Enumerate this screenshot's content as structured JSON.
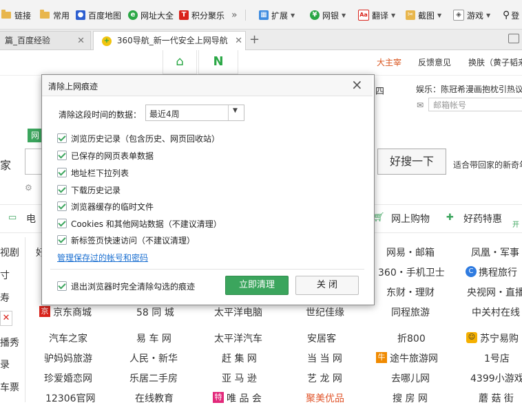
{
  "bookmarks": {
    "items": [
      {
        "label": "链接"
      },
      {
        "label": "常用"
      },
      {
        "label": "百度地图"
      },
      {
        "label": "网址大全"
      },
      {
        "label": "积分聚乐"
      },
      {
        "label": "扩展"
      },
      {
        "label": "网银"
      },
      {
        "label": "翻译"
      },
      {
        "label": "截图"
      },
      {
        "label": "游戏"
      },
      {
        "label": "登"
      }
    ],
    "more": "»"
  },
  "tabs": [
    {
      "label": "篇_百度经验"
    },
    {
      "label": "360导航_新一代安全上网导航"
    }
  ],
  "page": {
    "top_links": [
      "大主宰",
      "反馈意见",
      "换肤（黄子韬来"
    ],
    "weekday": "周四",
    "news": "娱乐：陈冠希漫画抱枕引热议",
    "email_placeholder": "邮箱帐号",
    "search_tab": "网",
    "search_prefix": "家",
    "search_button": "好搜一下",
    "search_hint": "适合带回家的新奇年",
    "cats_left": "电",
    "cats_right": [
      {
        "label": "网上购物"
      },
      {
        "label": "好药特惠"
      },
      {
        "label": "开"
      }
    ],
    "left_col": [
      "视剧",
      "寸",
      "寿",
      "",
      "播秀",
      "录",
      "车票"
    ],
    "sites": [
      [
        "",
        "",
        "",
        "",
        "网易・邮箱",
        "凤凰・军事"
      ],
      [
        "",
        "",
        "",
        "",
        "360・手机卫士",
        "携程旅行"
      ],
      [
        "",
        "",
        "",
        "",
        "东财・理财",
        "央视网・直播"
      ],
      [
        "京东商城",
        "58 同 城",
        "太平洋电脑",
        "世纪佳缘",
        "同程旅游",
        "中关村在线"
      ],
      [
        "汽车之家",
        "易 车 网",
        "太平洋汽车",
        "安居客",
        "折800",
        "苏宁易购"
      ],
      [
        "驴妈妈旅游",
        "人民・新华",
        "赶 集 网",
        "当 当 网",
        "途牛旅游网",
        "1号店"
      ],
      [
        "珍爱婚恋网",
        "乐居二手房",
        "亚 马 逊",
        "艺 龙 网",
        "去哪儿网",
        "4399小游戏"
      ],
      [
        "12306官网",
        "在线教育",
        "唯 品 会",
        "聚美优品",
        "搜 房 网",
        "蘑 菇 街"
      ]
    ],
    "header_first": "好"
  },
  "dialog": {
    "title": "清除上网痕迹",
    "period_label": "清除这段时间的数据：",
    "period_value": "最近4周",
    "options": [
      "浏览历史记录（包含历史、网页回收站）",
      "已保存的网页表单数据",
      "地址栏下拉列表",
      "下载历史记录",
      "浏览器缓存的临时文件",
      "Cookies 和其他网站数据（不建议清理）",
      "新标签页快速访问（不建议清理）"
    ],
    "manage_link": "管理保存过的帐号和密码",
    "exit_option": "退出浏览器时完全清除勾选的痕迹",
    "confirm": "立即清理",
    "cancel": "关 闭"
  },
  "colors": {
    "accent": "#2aa745",
    "link": "#1a6fd1",
    "brand_red": "#d9231b"
  }
}
